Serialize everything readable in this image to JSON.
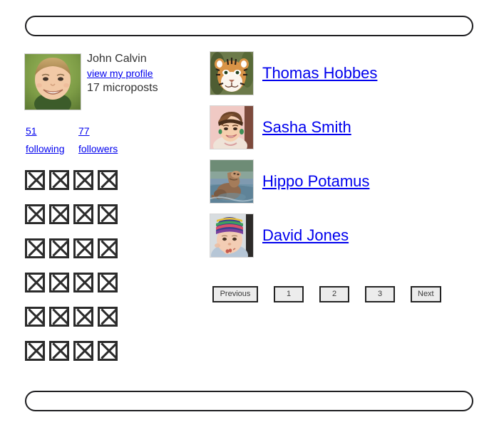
{
  "header": {
    "bar_label": ""
  },
  "footer": {
    "bar_label": ""
  },
  "sidebar": {
    "user": {
      "name": "John Calvin",
      "profile_link": "view my profile",
      "microposts": "17 microposts",
      "avatar_icon": "gravatar-child-photo"
    },
    "stats": [
      {
        "count": "51",
        "label": "following"
      },
      {
        "count": "77",
        "label": "followers"
      }
    ],
    "grid": {
      "columns": 4,
      "rows": 6,
      "count": 24,
      "item_icon": "broken-image-icon"
    }
  },
  "user_list": {
    "users": [
      {
        "name": "Thomas Hobbes",
        "avatar_icon": "tiger-avatar"
      },
      {
        "name": "Sasha Smith",
        "avatar_icon": "woman-avatar"
      },
      {
        "name": "Hippo Potamus",
        "avatar_icon": "hippo-avatar"
      },
      {
        "name": "David Jones",
        "avatar_icon": "baby-hat-avatar"
      }
    ]
  },
  "pagination": {
    "previous": "Previous",
    "pages": [
      "1",
      "2",
      "3"
    ],
    "next": "Next"
  },
  "colors": {
    "link": "#0000ee",
    "text": "#333333",
    "border": "#1d1d1f",
    "button_bg": "#ececec",
    "button_border": "#232323"
  }
}
